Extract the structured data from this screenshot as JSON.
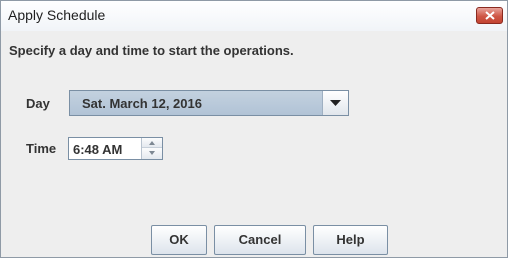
{
  "dialog": {
    "title": "Apply Schedule",
    "instructions": "Specify a day and time to start the operations."
  },
  "icons": {
    "close": "close-icon",
    "dropdown": "chevron-down-icon",
    "spin_up": "spinner-up-icon",
    "spin_down": "spinner-down-icon"
  },
  "fields": {
    "day_label": "Day",
    "day_value": "Sat. March 12, 2016",
    "time_label": "Time",
    "time_value": "6:48 AM"
  },
  "buttons": {
    "ok": "OK",
    "cancel": "Cancel",
    "help": "Help"
  },
  "colors": {
    "close_button": "#c9503e",
    "combo_background": "#b8c8d9",
    "dialog_background": "#eeeeee"
  }
}
